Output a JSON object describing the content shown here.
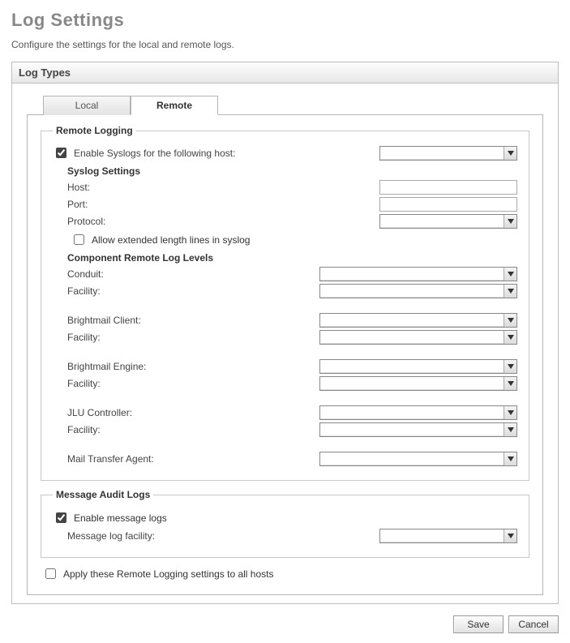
{
  "page": {
    "title": "Log Settings",
    "subtitle": "Configure the settings for the local and remote logs."
  },
  "panel": {
    "header": "Log Types"
  },
  "tabs": {
    "local": "Local",
    "remote": "Remote"
  },
  "remote_logging": {
    "legend": "Remote Logging",
    "enable_label": "Enable Syslogs for the following host:",
    "enable_checked": true,
    "host_select": "",
    "syslog_heading": "Syslog Settings",
    "host_label": "Host:",
    "host_value": "",
    "port_label": "Port:",
    "port_value": "",
    "protocol_label": "Protocol:",
    "protocol_value": "",
    "allow_ext_label": "Allow extended length lines in syslog",
    "allow_ext_checked": false,
    "levels_heading": "Component Remote Log Levels",
    "components": {
      "conduit_label": "Conduit:",
      "conduit_facility_label": "Facility:",
      "brightmail_client_label": "Brightmail Client:",
      "brightmail_client_facility_label": "Facility:",
      "brightmail_engine_label": "Brightmail Engine:",
      "brightmail_engine_facility_label": "Facility:",
      "jlu_label": "JLU Controller:",
      "jlu_facility_label": "Facility:",
      "mta_label": "Mail Transfer Agent:"
    }
  },
  "audit": {
    "legend": "Message Audit Logs",
    "enable_label": "Enable message logs",
    "enable_checked": true,
    "facility_label": "Message log facility:",
    "facility_value": ""
  },
  "apply_all": {
    "label": "Apply these Remote Logging settings to all hosts",
    "checked": false
  },
  "buttons": {
    "save": "Save",
    "cancel": "Cancel"
  }
}
